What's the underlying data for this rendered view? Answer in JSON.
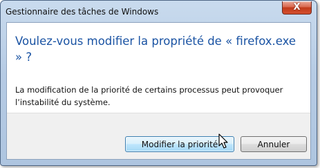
{
  "window": {
    "title": "Gestionnaire des tâches de Windows",
    "close_label": "X"
  },
  "dialog": {
    "main_instruction": "Voulez-vous modifier la propriété de « firefox.exe » ?",
    "content": "La modification de la priorité de certains processus peut provoquer l’instabilité du système."
  },
  "buttons": {
    "confirm_label": "Modifier la priorité",
    "cancel_label": "Annuler"
  },
  "colors": {
    "instruction_text": "#1a53a3",
    "frame": "#b6cbe4",
    "close_button": "#c13a1b",
    "primary_button_border": "#3c7fb1"
  },
  "icons": {
    "close": "close-icon",
    "cursor": "mouse-pointer-icon"
  }
}
